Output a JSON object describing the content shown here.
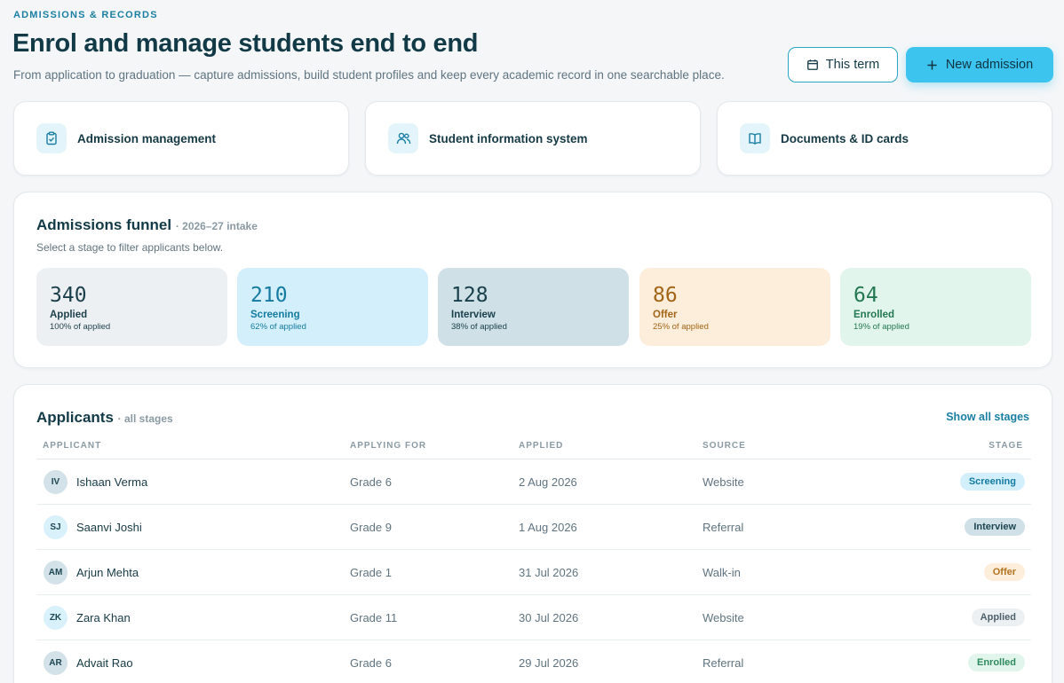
{
  "header": {
    "eyebrow": "ADMISSIONS & RECORDS",
    "title": "Enrol and manage students end to end",
    "subtitle": "From application to graduation — capture admissions, build student profiles and keep every academic record in one searchable place.",
    "term_button": "This term",
    "new_button": "New admission"
  },
  "modules": [
    {
      "label": "Admission management",
      "icon": "clipboard-check-icon"
    },
    {
      "label": "Student information system",
      "icon": "users-icon"
    },
    {
      "label": "Documents & ID cards",
      "icon": "book-open-icon"
    }
  ],
  "funnel": {
    "title": "Admissions funnel",
    "subtitle": "· 2026–27 intake",
    "hint": "Select a stage to filter applicants below.",
    "stages": [
      {
        "count": "340",
        "name": "Applied",
        "pct": "100% of applied",
        "bg": "#edf0f2",
        "color": "#1b3f4b"
      },
      {
        "count": "210",
        "name": "Screening",
        "pct": "62% of applied",
        "bg": "#d3effb",
        "color": "#147aa1"
      },
      {
        "count": "128",
        "name": "Interview",
        "pct": "38% of applied",
        "bg": "#cfe0e6",
        "color": "#183f4c"
      },
      {
        "count": "86",
        "name": "Offer",
        "pct": "25% of applied",
        "bg": "#fdeedb",
        "color": "#a26416"
      },
      {
        "count": "64",
        "name": "Enrolled",
        "pct": "19% of applied",
        "bg": "#e1f5ec",
        "color": "#247851"
      }
    ]
  },
  "applicants": {
    "title": "Applicants",
    "subtitle": "· all stages",
    "show_all": "Show all stages",
    "columns": [
      "APPLICANT",
      "APPLYING FOR",
      "APPLIED",
      "SOURCE",
      "STAGE"
    ],
    "rows": [
      {
        "initials": "IV",
        "name": "Ishaan Verma",
        "grade": "Grade 6",
        "date": "2 Aug 2026",
        "source": "Website",
        "stage": "Screening",
        "avatar_bg": "#d2e2e8",
        "badge_bg": "#d3effb",
        "badge_color": "#147aa1"
      },
      {
        "initials": "SJ",
        "name": "Saanvi Joshi",
        "grade": "Grade 9",
        "date": "1 Aug 2026",
        "source": "Referral",
        "stage": "Interview",
        "avatar_bg": "#d9f1fb",
        "badge_bg": "#cfe0e6",
        "badge_color": "#1d4552"
      },
      {
        "initials": "AM",
        "name": "Arjun Mehta",
        "grade": "Grade 1",
        "date": "31 Jul 2026",
        "source": "Walk-in",
        "stage": "Offer",
        "avatar_bg": "#d2e2e8",
        "badge_bg": "#fdeedb",
        "badge_color": "#b5731f"
      },
      {
        "initials": "ZK",
        "name": "Zara Khan",
        "grade": "Grade 11",
        "date": "30 Jul 2026",
        "source": "Website",
        "stage": "Applied",
        "avatar_bg": "#d9f1fb",
        "badge_bg": "#edf0f2",
        "badge_color": "#4d626c"
      },
      {
        "initials": "AR",
        "name": "Advait Rao",
        "grade": "Grade 6",
        "date": "29 Jul 2026",
        "source": "Referral",
        "stage": "Enrolled",
        "avatar_bg": "#d2e2e8",
        "badge_bg": "#e1f5ec",
        "badge_color": "#2e8a5e"
      }
    ]
  }
}
